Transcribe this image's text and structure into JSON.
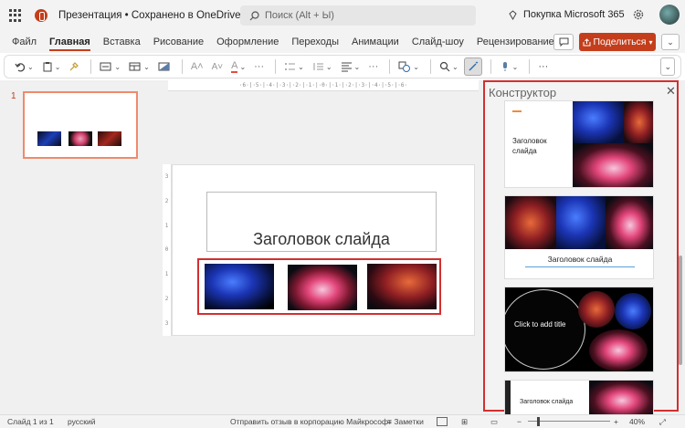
{
  "titlebar": {
    "doc_title": "Презентация  •  Сохранено в OneDrive",
    "search_placeholder": "Поиск (Alt + Ы)",
    "buy_label": "Покупка Microsoft 365"
  },
  "menu": {
    "items": [
      "Файл",
      "Главная",
      "Вставка",
      "Рисование",
      "Оформление",
      "Переходы",
      "Анимации",
      "Слайд-шоу",
      "Рецензирование"
    ],
    "active": "Главная",
    "share_label": "Поделиться"
  },
  "thumbnails": {
    "slide_number": "1"
  },
  "ruler": {
    "h_ticks": "·6·|·5·|·4·|·3·|·2·|·1·|·0·|·1·|·2·|·3·|·4·|·5·|·6·",
    "v_ticks": [
      "3",
      "2",
      "1",
      "0",
      "1",
      "2",
      "3"
    ]
  },
  "slide": {
    "title": "Заголовок слайда"
  },
  "designer": {
    "title": "Конструктор",
    "cards": [
      {
        "caption": "Заголовок слайда"
      },
      {
        "caption": "Заголовок слайда"
      },
      {
        "caption": "Click to add title"
      },
      {
        "caption": "Заголовок слайда"
      }
    ]
  },
  "status": {
    "slide_info": "Слайд 1 из 1",
    "language": "русский",
    "feedback": "Отправить отзыв в корпорацию Майкрософт",
    "notes": "Заметки",
    "zoom": "40%"
  },
  "colors": {
    "accent": "#c43e1c",
    "highlight": "#d32f2f"
  }
}
